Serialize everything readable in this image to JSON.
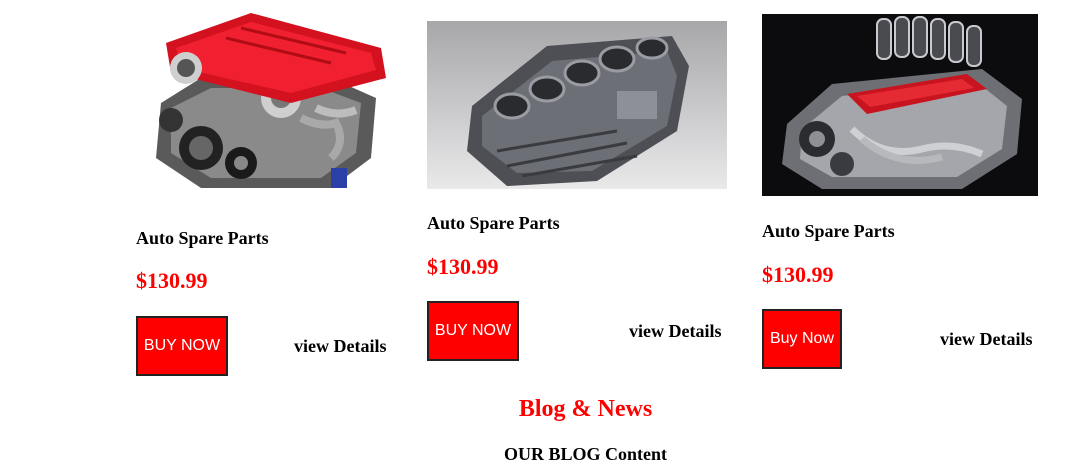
{
  "products": [
    {
      "image_icon": "red-v8-engine-image",
      "title": "Auto Spare Parts",
      "price": "$130.99",
      "buy_label": "BUY NOW",
      "details_label": "view Details"
    },
    {
      "image_icon": "engine-block-image",
      "title": "Auto Spare Parts",
      "price": "$130.99",
      "buy_label": "BUY NOW",
      "details_label": "view Details"
    },
    {
      "image_icon": "racing-engine-image",
      "title": "Auto Spare Parts",
      "price": "$130.99",
      "buy_label": "Buy Now",
      "details_label": "view Details"
    }
  ],
  "blog": {
    "title": "Blog & News",
    "subtitle": "OUR BLOG Content"
  },
  "colors": {
    "accent": "#ff0000",
    "text": "#000000",
    "background": "#ffffff"
  }
}
